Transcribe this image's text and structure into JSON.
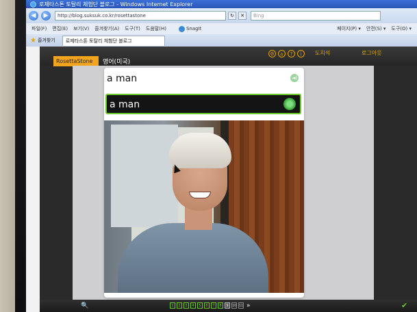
{
  "browser": {
    "title": "로제타스톤 토탈리 체험단 블로그 - Windows Internet Explorer",
    "address": "http://blog.suksuk.co.kr/rosettastone",
    "search_placeholder": "Bing",
    "menu": [
      "파일(F)",
      "편집(E)",
      "보기(V)",
      "즐겨찾기(A)",
      "도구(T)",
      "도움말(H)"
    ],
    "snagit": "SnagIt",
    "tools": [
      "페이지(P) ▾",
      "안전(S) ▾",
      "도구(O) ▾"
    ],
    "favorites_label": "즐겨찾기",
    "tab_title": "로제타스톤 토탈리 체험단 블로그"
  },
  "app": {
    "brand": "RosettaStone",
    "language": "영어(미국)",
    "user": "도치석",
    "logout": "로그아웃",
    "phrase": "a man",
    "answer": "a man",
    "pages": [
      "1",
      "2",
      "3",
      "4",
      "5",
      "6",
      "7",
      "8",
      "9",
      "10",
      "11"
    ],
    "current_page_index": 8,
    "colors": {
      "accent": "#f2a51c",
      "correct": "#6ecb2c"
    }
  }
}
